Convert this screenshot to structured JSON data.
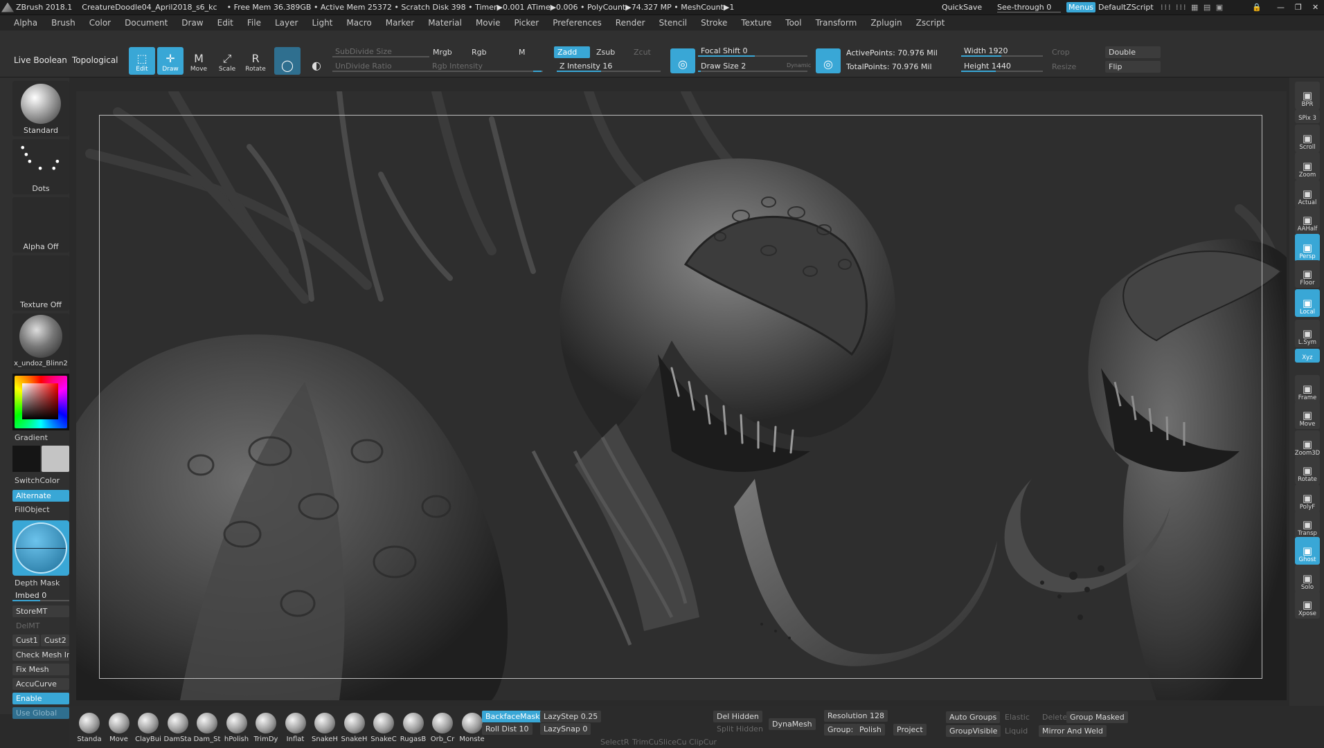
{
  "titlebar": {
    "app": "ZBrush 2018.1",
    "document": "CreatureDoodle04_April2018_s6_kc",
    "stats": "• Free Mem 36.389GB • Active Mem 25372 • Scratch Disk 398 • Timer▶0.001 ATime▶0.006 • PolyCount▶74.327 MP • MeshCount▶1",
    "quicksave": "QuickSave",
    "see_through": "See-through   0",
    "menus": "Menus",
    "script": "DefaultZScript"
  },
  "menu": [
    "Alpha",
    "Brush",
    "Color",
    "Document",
    "Draw",
    "Edit",
    "File",
    "Layer",
    "Light",
    "Macro",
    "Marker",
    "Material",
    "Movie",
    "Picker",
    "Preferences",
    "Render",
    "Stencil",
    "Stroke",
    "Texture",
    "Tool",
    "Transform",
    "Zplugin",
    "Zscript"
  ],
  "top": {
    "live_boolean": "Live Boolean",
    "topological": "Topological",
    "edit": "Edit",
    "draw": "Draw",
    "move": "Move",
    "scale": "Scale",
    "rotate": "Rotate",
    "subdivide_size": "SubDivide Size",
    "undivide_ratio": "UnDivide Ratio",
    "mrgb": "Mrgb",
    "rgb": "Rgb",
    "m": "M",
    "rgb_intensity": "Rgb Intensity",
    "zadd": "Zadd",
    "zsub": "Zsub",
    "zcut": "Zcut",
    "z_intensity": "Z Intensity 16",
    "focal_shift": "Focal Shift 0",
    "draw_size": "Draw Size 2",
    "dynamic": "Dynamic",
    "active_points": "ActivePoints: 70.976 Mil",
    "total_points": "TotalPoints: 70.976 Mil",
    "width": "Width 1920",
    "height": "Height 1440",
    "crop": "Crop",
    "resize": "Resize",
    "double": "Double",
    "flip": "Flip"
  },
  "left": {
    "brush": "Standard",
    "stroke": "Dots",
    "alpha": "Alpha Off",
    "texture": "Texture Off",
    "material": "x_undoz_Blinn2",
    "gradient": "Gradient",
    "switch_color": "SwitchColor",
    "alternate": "Alternate",
    "fill_object": "FillObject",
    "depth_mask": "Depth Mask",
    "imbed": "Imbed 0",
    "store_mt": "StoreMT",
    "del_mt": "DelMT",
    "cust1": "Cust1",
    "cust2": "Cust2",
    "check_mesh": "Check Mesh In",
    "fix_mesh": "Fix Mesh",
    "accucurve": "AccuCurve",
    "enable": "Enable",
    "use_global": "Use Global"
  },
  "right": [
    {
      "icon": "bpr-icon",
      "label": "BPR",
      "on": false
    },
    {
      "icon": "spix-icon",
      "label": "SPix 3",
      "on": false
    },
    {
      "icon": "scroll-icon",
      "label": "Scroll",
      "on": false
    },
    {
      "icon": "zoom-icon",
      "label": "Zoom",
      "on": false
    },
    {
      "icon": "actual-icon",
      "label": "Actual",
      "on": false
    },
    {
      "icon": "aahalf-icon",
      "label": "AAHalf",
      "on": false
    },
    {
      "icon": "persp-icon",
      "label": "Persp",
      "on": true
    },
    {
      "icon": "floor-icon",
      "label": "Floor",
      "on": false
    },
    {
      "icon": "local-icon",
      "label": "Local",
      "on": true
    },
    {
      "icon": "lsym-icon",
      "label": "L.Sym",
      "on": false
    },
    {
      "icon": "xyz-icon",
      "label": "Xyz",
      "on": true
    },
    {
      "icon": "frame-icon",
      "label": "Frame",
      "on": false
    },
    {
      "icon": "move-icon",
      "label": "Move",
      "on": false
    },
    {
      "icon": "zoom3d-icon",
      "label": "Zoom3D",
      "on": false
    },
    {
      "icon": "rotate-icon",
      "label": "Rotate",
      "on": false
    },
    {
      "icon": "polyf-icon",
      "label": "PolyF",
      "on": false
    },
    {
      "icon": "transp-icon",
      "label": "Transp",
      "on": false
    },
    {
      "icon": "ghost-icon",
      "label": "Ghost",
      "on": true
    },
    {
      "icon": "solo-icon",
      "label": "Solo",
      "on": false
    },
    {
      "icon": "xpose-icon",
      "label": "Xpose",
      "on": false
    }
  ],
  "bottom": {
    "brushes": [
      "Standa",
      "Move",
      "ClayBui",
      "DamSta",
      "Dam_St",
      "hPolish",
      "TrimDy",
      "Inflat",
      "SnakeH",
      "SnakeH",
      "SnakeC",
      "RugasB",
      "Orb_Cr",
      "Monste"
    ],
    "backface_mask": "BackfaceMask",
    "roll_dist": "Roll Dist 10",
    "lazystep": "LazyStep 0.25",
    "lazysnap": "LazySnap 0",
    "select_r": "SelectR",
    "trimcu": "TrimCu",
    "slicecu": "SliceCu",
    "clipcur": "ClipCur",
    "del_hidden": "Del Hidden",
    "split_hidden": "Split Hidden",
    "dynamesh": "DynaMesh",
    "resolution": "Resolution 128",
    "group": "Group:",
    "polish": "Polish",
    "project": "Project",
    "auto_groups": "Auto Groups",
    "group_visible": "GroupVisible",
    "elastic": "Elastic",
    "liquid": "Liquid",
    "delete": "Delete",
    "group_masked": "Group Masked",
    "mirror_weld": "Mirror And Weld"
  },
  "colors": {
    "accent": "#39a7d6",
    "panel": "#303030",
    "canvas": "#2e2e2e"
  }
}
